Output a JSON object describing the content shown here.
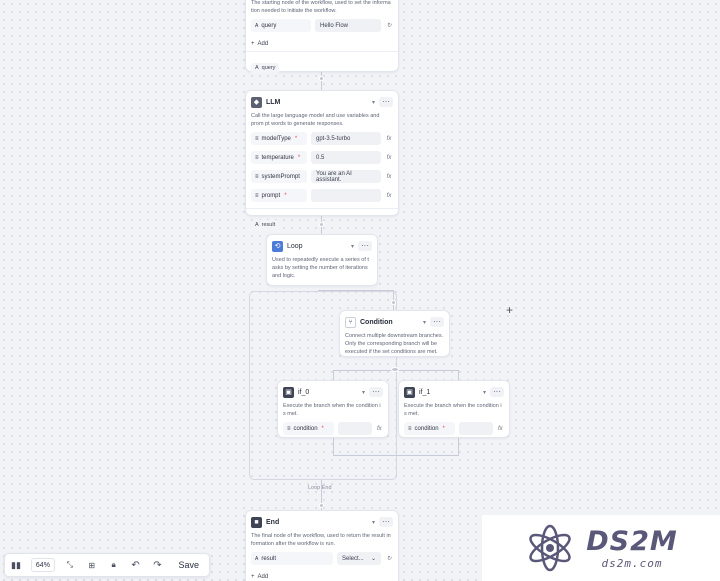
{
  "start_node": {
    "desc": "The starting node of the workflow, used to set the informa tion needed to initiate the workflow.",
    "input_key": "query",
    "input_value": "Hello Flow",
    "add_label": "Add",
    "output_label": "query"
  },
  "llm_node": {
    "title": "LLM",
    "desc": "Call the large language model and use variables and prom pt words to generate responses.",
    "params": [
      {
        "key": "modelType",
        "value": "gpt-3.5-turbo"
      },
      {
        "key": "temperature",
        "value": "0.5"
      },
      {
        "key": "systemPrompt",
        "value": "You are an AI assistant."
      },
      {
        "key": "prompt",
        "value": ""
      }
    ],
    "output_label": "result"
  },
  "loop_node": {
    "title": "Loop",
    "desc": "Used to repeatedly execute a series of t asks by setting the number of iterations and logic.",
    "loop_end_label": "Loop End"
  },
  "condition_node": {
    "title": "Condition",
    "desc": "Connect multiple downstream branches. Only the corresponding branch will be executed if the set conditions are met."
  },
  "branches": [
    {
      "title": "if_0",
      "desc": "Execute the branch when the condition i s met.",
      "field": "condition"
    },
    {
      "title": "if_1",
      "desc": "Execute the branch when the condition i s met.",
      "field": "condition"
    }
  ],
  "end_node": {
    "title": "End",
    "desc": "The final node of the workflow, used to return the result in formation after the workflow is run.",
    "output_key": "result",
    "select_placeholder": "Select...",
    "add_label": "Add"
  },
  "toolbar": {
    "zoom": "64%",
    "save_label": "Save"
  },
  "watermark": {
    "brand": "DS2M",
    "domain": "ds2m.com"
  }
}
